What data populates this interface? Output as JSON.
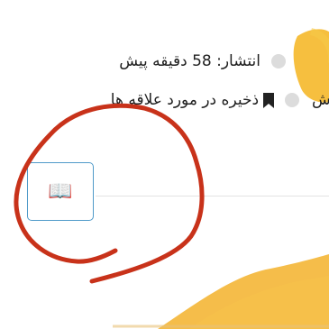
{
  "meta": {
    "published_text": "انتشار: 58 دقیقه پیش",
    "save_favorite_text": "ذخیره در مورد علاقه ها",
    "partial_text": "رش"
  },
  "icons": {
    "bullet": "circle-bullet-icon",
    "bookmark": "bookmark-icon",
    "reader": "open-book-icon",
    "reader_glyph": "📖"
  },
  "colors": {
    "highlighter_yellow": "#f5b82a",
    "annotation_red": "#c8321a",
    "button_border": "#4f9ac9",
    "bullet_gray": "#dcdcdc"
  }
}
